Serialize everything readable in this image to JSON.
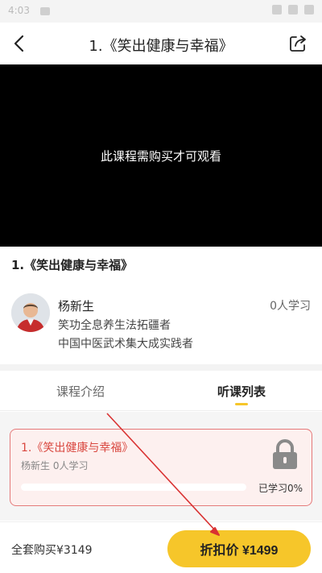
{
  "status_bar": {
    "time": "4:03"
  },
  "nav": {
    "title": "1.《笑出健康与幸福》"
  },
  "player": {
    "message": "此课程需购买才可观看"
  },
  "course": {
    "title": "1.《笑出健康与幸福》"
  },
  "teacher": {
    "name": "杨新生",
    "learners": "0人学习",
    "desc_line1": "笑功全息养生法拓疆者",
    "desc_line2": "中国中医武术集大成实践者"
  },
  "tabs": [
    {
      "label": "课程介绍",
      "active": false
    },
    {
      "label": "听课列表",
      "active": true
    }
  ],
  "lesson": {
    "title": "1.《笑出健康与幸福》",
    "meta": "杨新生  0人学习",
    "progress": 0,
    "status": "已学习0%"
  },
  "footer": {
    "full_purchase": "全套购买¥3149",
    "buy_button": "折扣价 ¥1499"
  },
  "colors": {
    "accent": "#f6c62a",
    "lesson_highlight": "#d9473f",
    "annotation_arrow": "#d93232"
  },
  "icons": [
    "back-arrow-icon",
    "share-icon",
    "lock-icon"
  ]
}
